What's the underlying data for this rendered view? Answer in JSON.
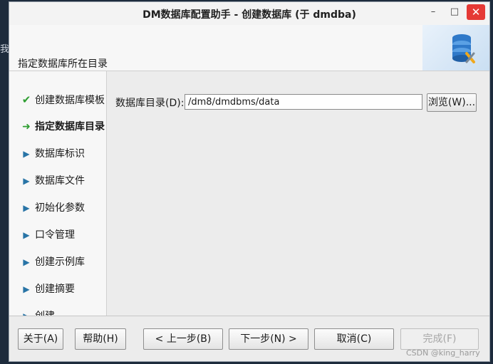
{
  "desktop": {
    "glyph": "我"
  },
  "window": {
    "title": "DM数据库配置助手 - 创建数据库 (于 dmdba)",
    "controls": {
      "minimize": "–",
      "maximize": "□",
      "close": "✕"
    }
  },
  "header": {
    "label": "指定数据库所在目录",
    "icon": "database-settings-icon"
  },
  "nav": {
    "items": [
      {
        "label": "创建数据库模板",
        "state": "done",
        "mark": "✔"
      },
      {
        "label": "指定数据库目录",
        "state": "current",
        "mark": "➜"
      },
      {
        "label": "数据库标识",
        "state": "pending",
        "mark": "▶"
      },
      {
        "label": "数据库文件",
        "state": "pending",
        "mark": "▶"
      },
      {
        "label": "初始化参数",
        "state": "pending",
        "mark": "▶"
      },
      {
        "label": "口令管理",
        "state": "pending",
        "mark": "▶"
      },
      {
        "label": "创建示例库",
        "state": "pending",
        "mark": "▶"
      },
      {
        "label": "创建摘要",
        "state": "pending",
        "mark": "▶"
      },
      {
        "label": "创建",
        "state": "pending",
        "mark": "▶"
      }
    ]
  },
  "form": {
    "dir_label": "数据库目录(D):",
    "dir_value": "/dm8/dmdbms/data",
    "browse": "浏览(W)..."
  },
  "footer": {
    "about": "关于(A)",
    "help": "帮助(H)",
    "prev": "< 上一步(B)",
    "next": "下一步(N) >",
    "cancel": "取消(C)",
    "finish": "完成(F)"
  },
  "watermark": "CSDN @king_harry"
}
